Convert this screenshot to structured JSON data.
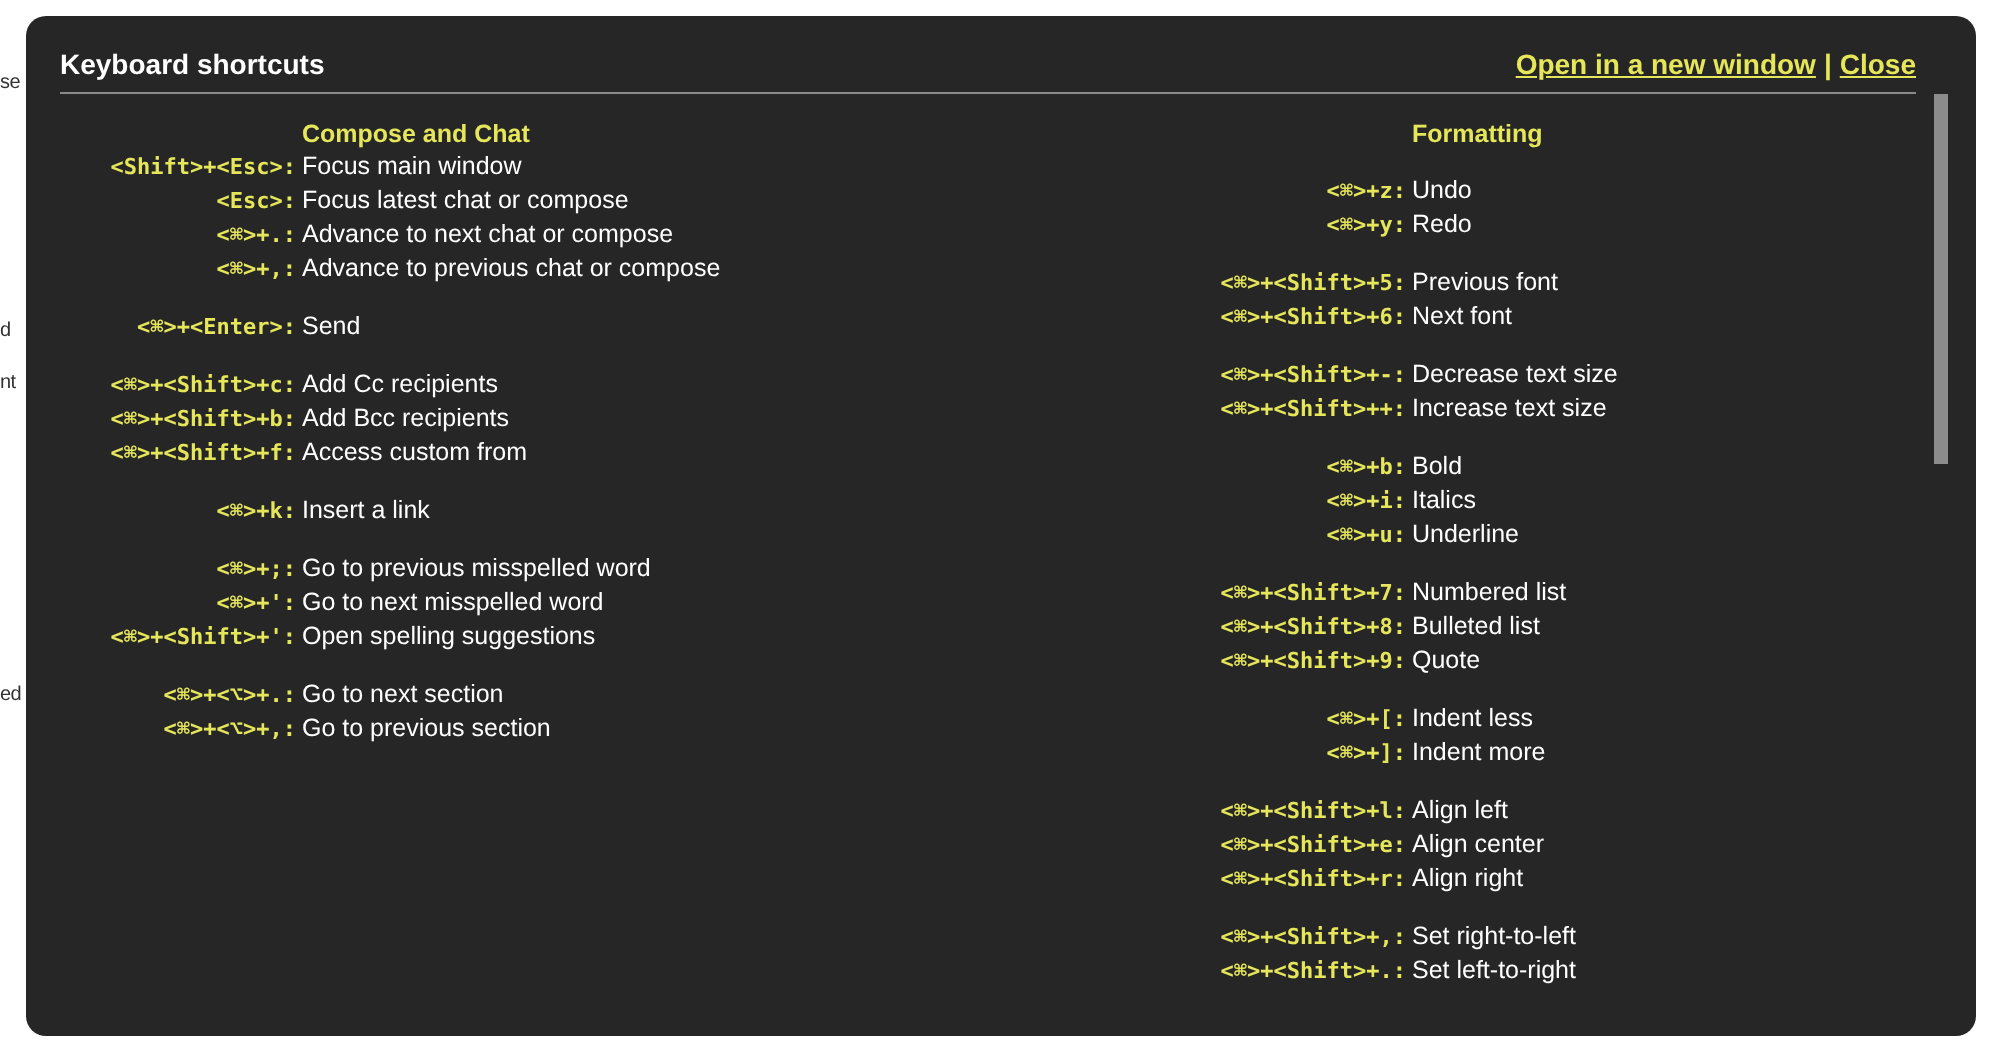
{
  "background_fragments": [
    "se",
    "d",
    "nt",
    "ed"
  ],
  "dialog": {
    "title": "Keyboard shortcuts",
    "links": [
      {
        "label": "Open in a new window"
      },
      {
        "label": "Close"
      }
    ],
    "separator": "|"
  },
  "columns": [
    {
      "heading": "Compose and Chat",
      "groups": [
        [
          {
            "keys": "<Shift>+<Esc>:",
            "action": "Focus main window"
          },
          {
            "keys": "<Esc>:",
            "action": "Focus latest chat or compose"
          },
          {
            "keys": "<⌘>+.:",
            "action": "Advance to next chat or compose"
          },
          {
            "keys": "<⌘>+,:",
            "action": "Advance to previous chat or compose"
          }
        ],
        [
          {
            "keys": "<⌘>+<Enter>:",
            "action": "Send"
          }
        ],
        [
          {
            "keys": "<⌘>+<Shift>+c:",
            "action": "Add Cc recipients"
          },
          {
            "keys": "<⌘>+<Shift>+b:",
            "action": "Add Bcc recipients"
          },
          {
            "keys": "<⌘>+<Shift>+f:",
            "action": "Access custom from"
          }
        ],
        [
          {
            "keys": "<⌘>+k:",
            "action": "Insert a link"
          }
        ],
        [
          {
            "keys": "<⌘>+;:",
            "action": "Go to previous misspelled word"
          },
          {
            "keys": "<⌘>+':",
            "action": "Go to next misspelled word"
          },
          {
            "keys": "<⌘>+<Shift>+':",
            "action": "Open spelling suggestions"
          }
        ],
        [
          {
            "keys": "<⌘>+<⌥>+.:",
            "action": "Go to next section"
          },
          {
            "keys": "<⌘>+<⌥>+,:",
            "action": "Go to previous section"
          }
        ]
      ]
    },
    {
      "heading": "Formatting",
      "groups": [
        [
          {
            "keys": "<⌘>+z:",
            "action": "Undo"
          },
          {
            "keys": "<⌘>+y:",
            "action": "Redo"
          }
        ],
        [
          {
            "keys": "<⌘>+<Shift>+5:",
            "action": "Previous font"
          },
          {
            "keys": "<⌘>+<Shift>+6:",
            "action": "Next font"
          }
        ],
        [
          {
            "keys": "<⌘>+<Shift>+-:",
            "action": "Decrease text size"
          },
          {
            "keys": "<⌘>+<Shift>++:",
            "action": "Increase text size"
          }
        ],
        [
          {
            "keys": "<⌘>+b:",
            "action": "Bold"
          },
          {
            "keys": "<⌘>+i:",
            "action": "Italics"
          },
          {
            "keys": "<⌘>+u:",
            "action": "Underline"
          }
        ],
        [
          {
            "keys": "<⌘>+<Shift>+7:",
            "action": "Numbered list"
          },
          {
            "keys": "<⌘>+<Shift>+8:",
            "action": "Bulleted list"
          },
          {
            "keys": "<⌘>+<Shift>+9:",
            "action": "Quote"
          }
        ],
        [
          {
            "keys": "<⌘>+[:",
            "action": "Indent less"
          },
          {
            "keys": "<⌘>+]:",
            "action": "Indent more"
          }
        ],
        [
          {
            "keys": "<⌘>+<Shift>+l:",
            "action": "Align left"
          },
          {
            "keys": "<⌘>+<Shift>+e:",
            "action": "Align center"
          },
          {
            "keys": "<⌘>+<Shift>+r:",
            "action": "Align right"
          }
        ],
        [
          {
            "keys": "<⌘>+<Shift>+,:",
            "action": "Set right-to-left"
          },
          {
            "keys": "<⌘>+<Shift>+.:",
            "action": "Set left-to-right"
          }
        ]
      ]
    }
  ]
}
